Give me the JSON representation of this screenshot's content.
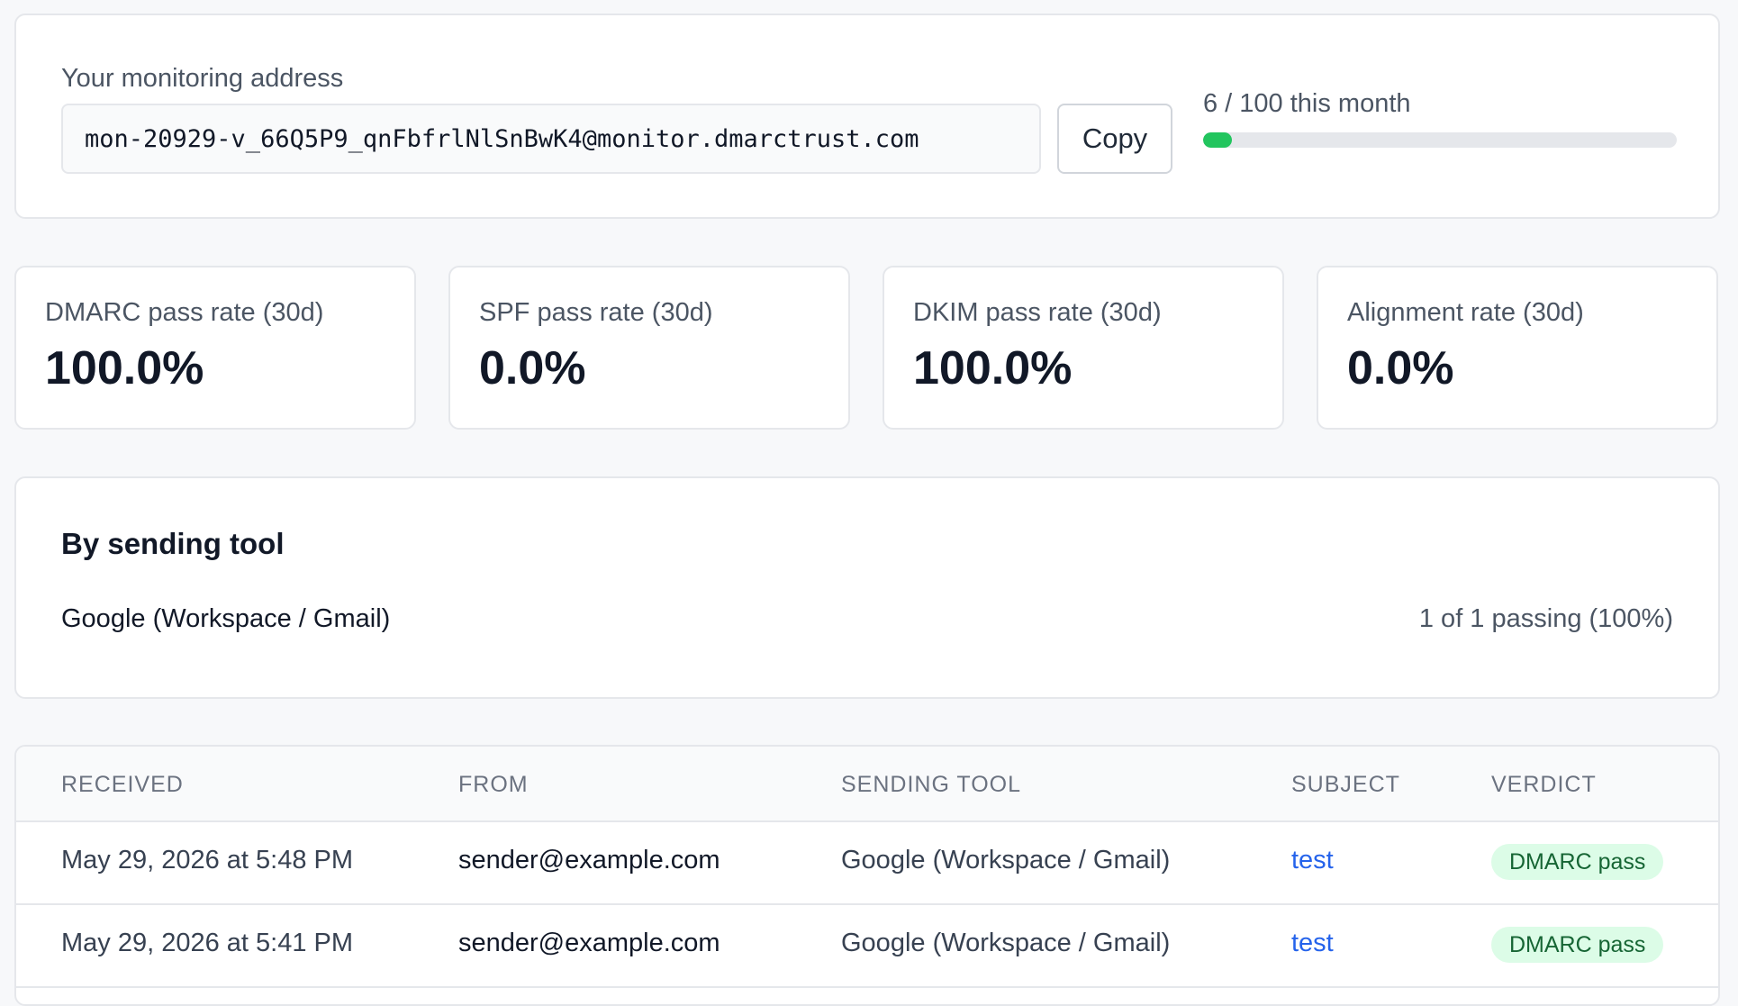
{
  "monitor": {
    "label": "Your monitoring address",
    "address": "mon-20929-v_66Q5P9_qnFbfrlNlSnBwK4@monitor.dmarctrust.com",
    "copy_label": "Copy",
    "usage_text": "6 / 100 this month",
    "usage_fraction": 0.06
  },
  "stats": [
    {
      "label": "DMARC pass rate (30d)",
      "value": "100.0%"
    },
    {
      "label": "SPF pass rate (30d)",
      "value": "0.0%"
    },
    {
      "label": "DKIM pass rate (30d)",
      "value": "100.0%"
    },
    {
      "label": "Alignment rate (30d)",
      "value": "0.0%"
    }
  ],
  "by_tool": {
    "title": "By sending tool",
    "tool": "Google (Workspace / Gmail)",
    "rate": "1 of 1 passing (100%)"
  },
  "table": {
    "headers": [
      "RECEIVED",
      "FROM",
      "SENDING TOOL",
      "SUBJECT",
      "VERDICT"
    ],
    "rows": [
      {
        "received": "May 29, 2026 at 5:48 PM",
        "from": "sender@example.com",
        "tool": "Google (Workspace / Gmail)",
        "subject": "test",
        "verdict": "DMARC pass"
      },
      {
        "received": "May 29, 2026 at 5:41 PM",
        "from": "sender@example.com",
        "tool": "Google (Workspace / Gmail)",
        "subject": "test",
        "verdict": "DMARC pass"
      }
    ]
  },
  "colors": {
    "accent_green": "#22c55e",
    "badge_bg": "#dcfce7",
    "badge_text": "#166534",
    "link_blue": "#2563eb"
  }
}
